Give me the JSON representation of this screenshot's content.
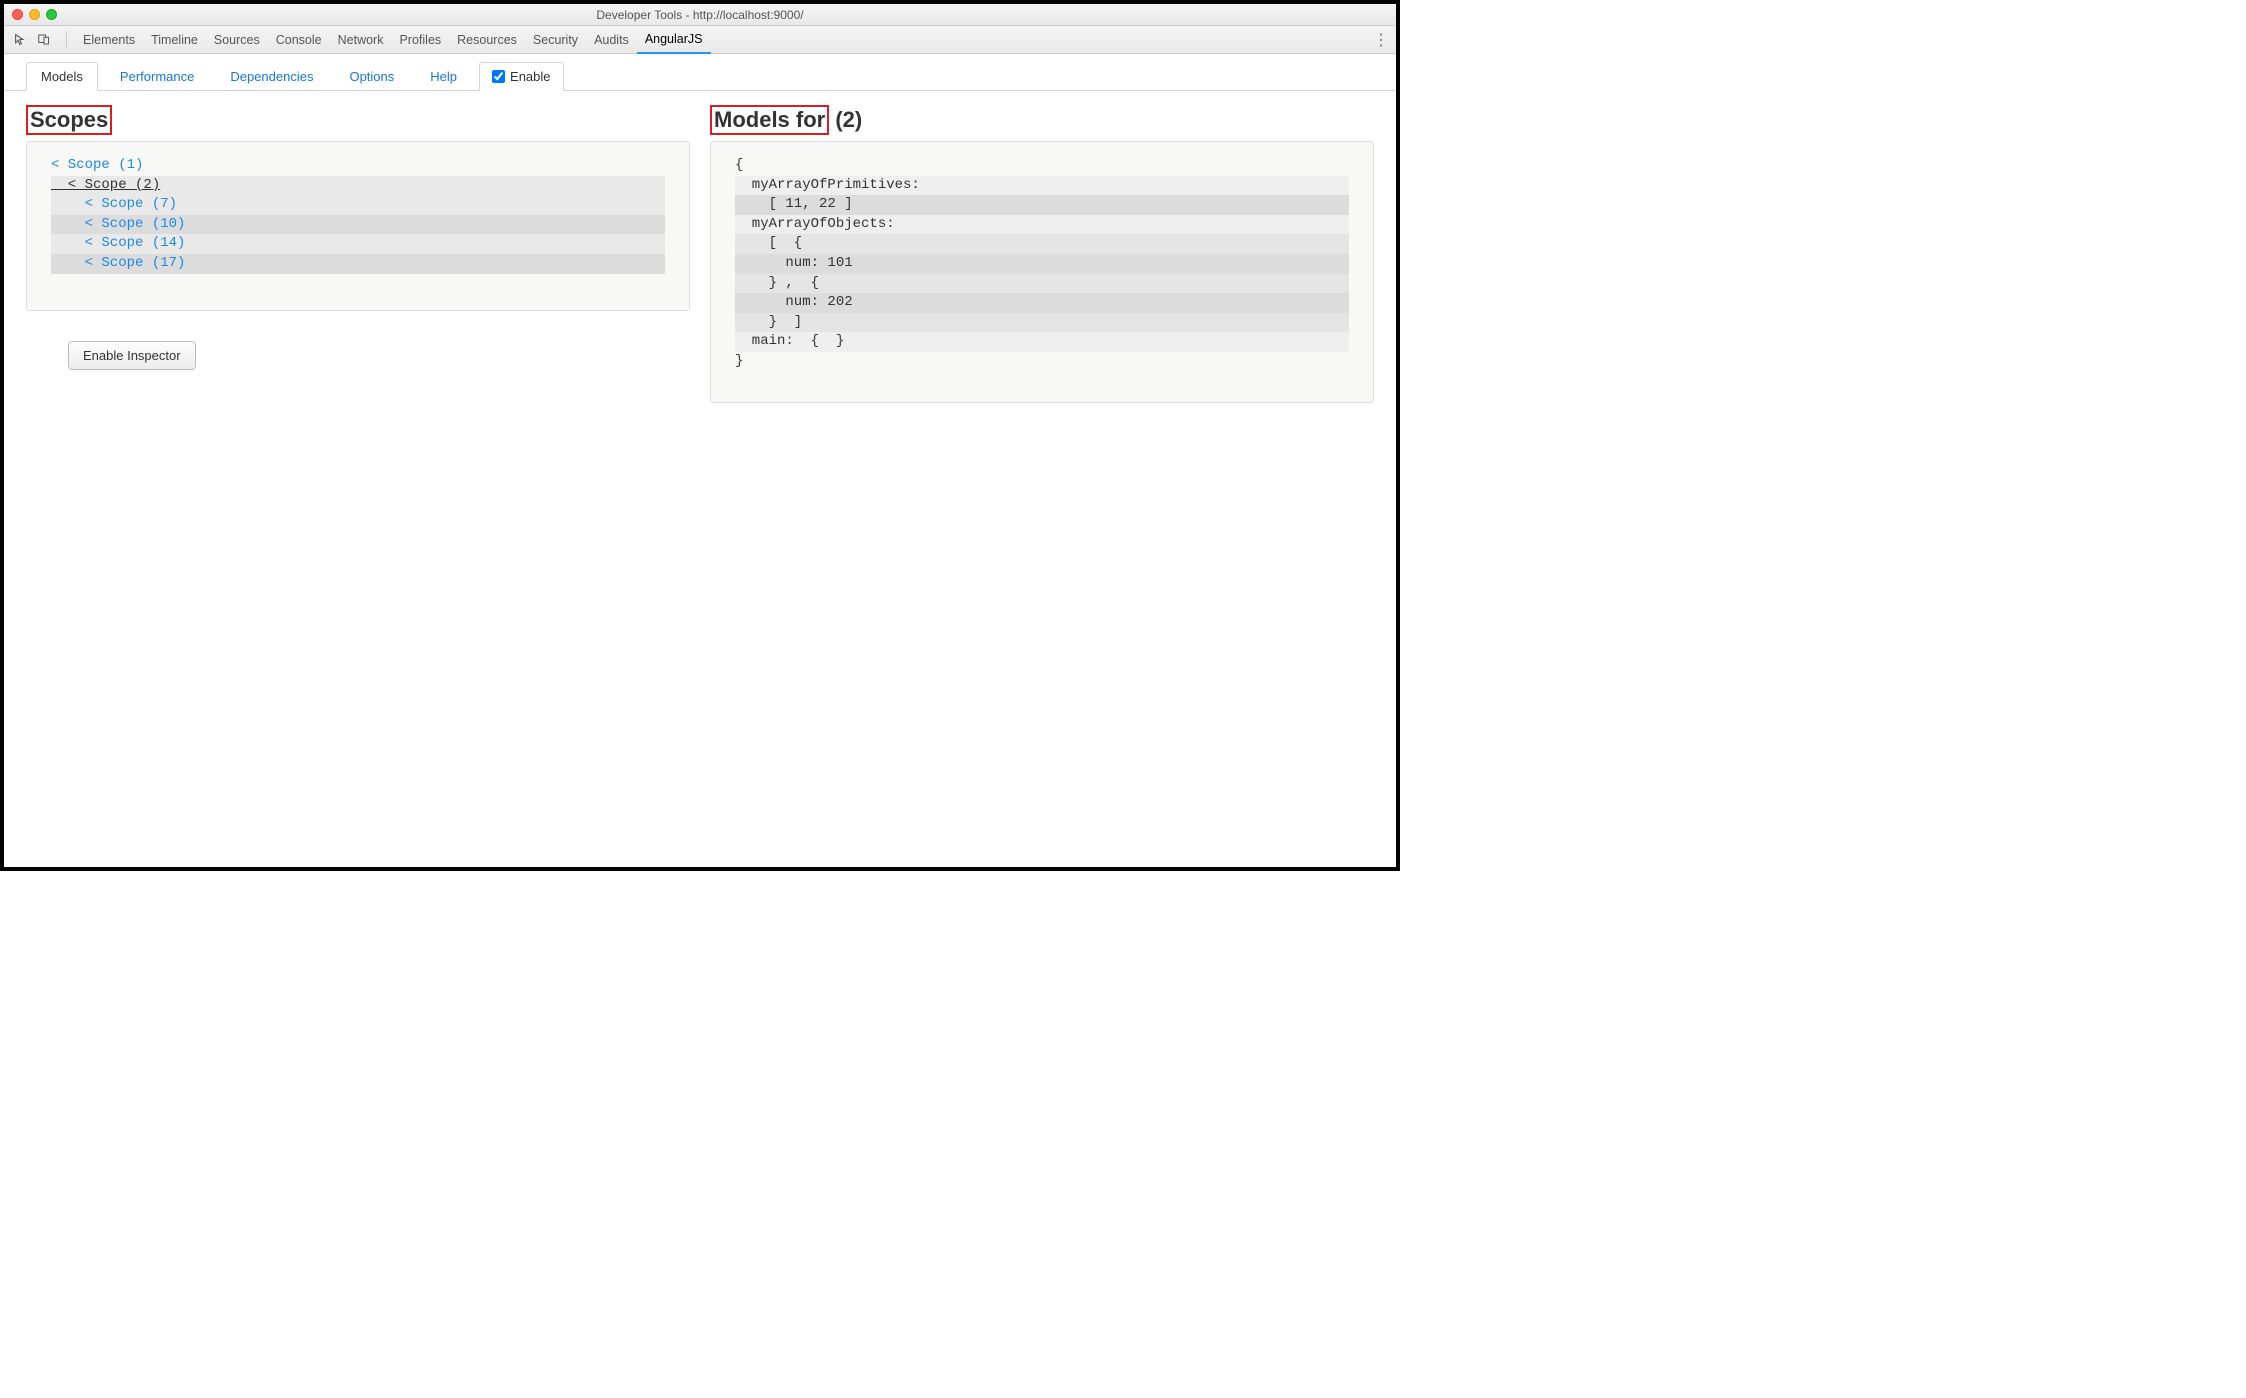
{
  "window": {
    "title": "Developer Tools - http://localhost:9000/"
  },
  "toolbar": {
    "panels": [
      "Elements",
      "Timeline",
      "Sources",
      "Console",
      "Network",
      "Profiles",
      "Resources",
      "Security",
      "Audits",
      "AngularJS"
    ],
    "active_panel": "AngularJS"
  },
  "subtabs": {
    "items": [
      "Models",
      "Performance",
      "Dependencies",
      "Options",
      "Help"
    ],
    "active": "Models",
    "enable_label": "Enable",
    "enable_checked": true
  },
  "scopes": {
    "title": "Scopes",
    "items": [
      {
        "indent": 0,
        "label": "< Scope (1)",
        "selected": false
      },
      {
        "indent": 1,
        "label": "< Scope (2)",
        "selected": true
      },
      {
        "indent": 2,
        "label": "< Scope (7)",
        "selected": false
      },
      {
        "indent": 2,
        "label": "< Scope (10)",
        "selected": false
      },
      {
        "indent": 2,
        "label": "< Scope (14)",
        "selected": false
      },
      {
        "indent": 2,
        "label": "< Scope (17)",
        "selected": false
      }
    ]
  },
  "models": {
    "title_prefix": "Models for",
    "title_suffix": "(2)",
    "lines": [
      {
        "indent": 0,
        "text": "{",
        "alt": ""
      },
      {
        "indent": 1,
        "text": "myArrayOfPrimitives:",
        "alt": "alt1"
      },
      {
        "indent": 2,
        "text": "[ 11, 22 ]",
        "alt": "alt2"
      },
      {
        "indent": 1,
        "text": "myArrayOfObjects:",
        "alt": "alt1"
      },
      {
        "indent": 2,
        "text": "[  {",
        "alt": "alt3"
      },
      {
        "indent": 3,
        "text": "num: 101",
        "alt": "alt2"
      },
      {
        "indent": 2,
        "text": "} ,  {",
        "alt": "alt3"
      },
      {
        "indent": 3,
        "text": "num: 202",
        "alt": "alt2"
      },
      {
        "indent": 2,
        "text": "}  ]",
        "alt": "alt3"
      },
      {
        "indent": 1,
        "text": "main:  {  }",
        "alt": "alt1"
      },
      {
        "indent": 0,
        "text": "}",
        "alt": ""
      }
    ]
  },
  "buttons": {
    "enable_inspector": "Enable Inspector"
  }
}
